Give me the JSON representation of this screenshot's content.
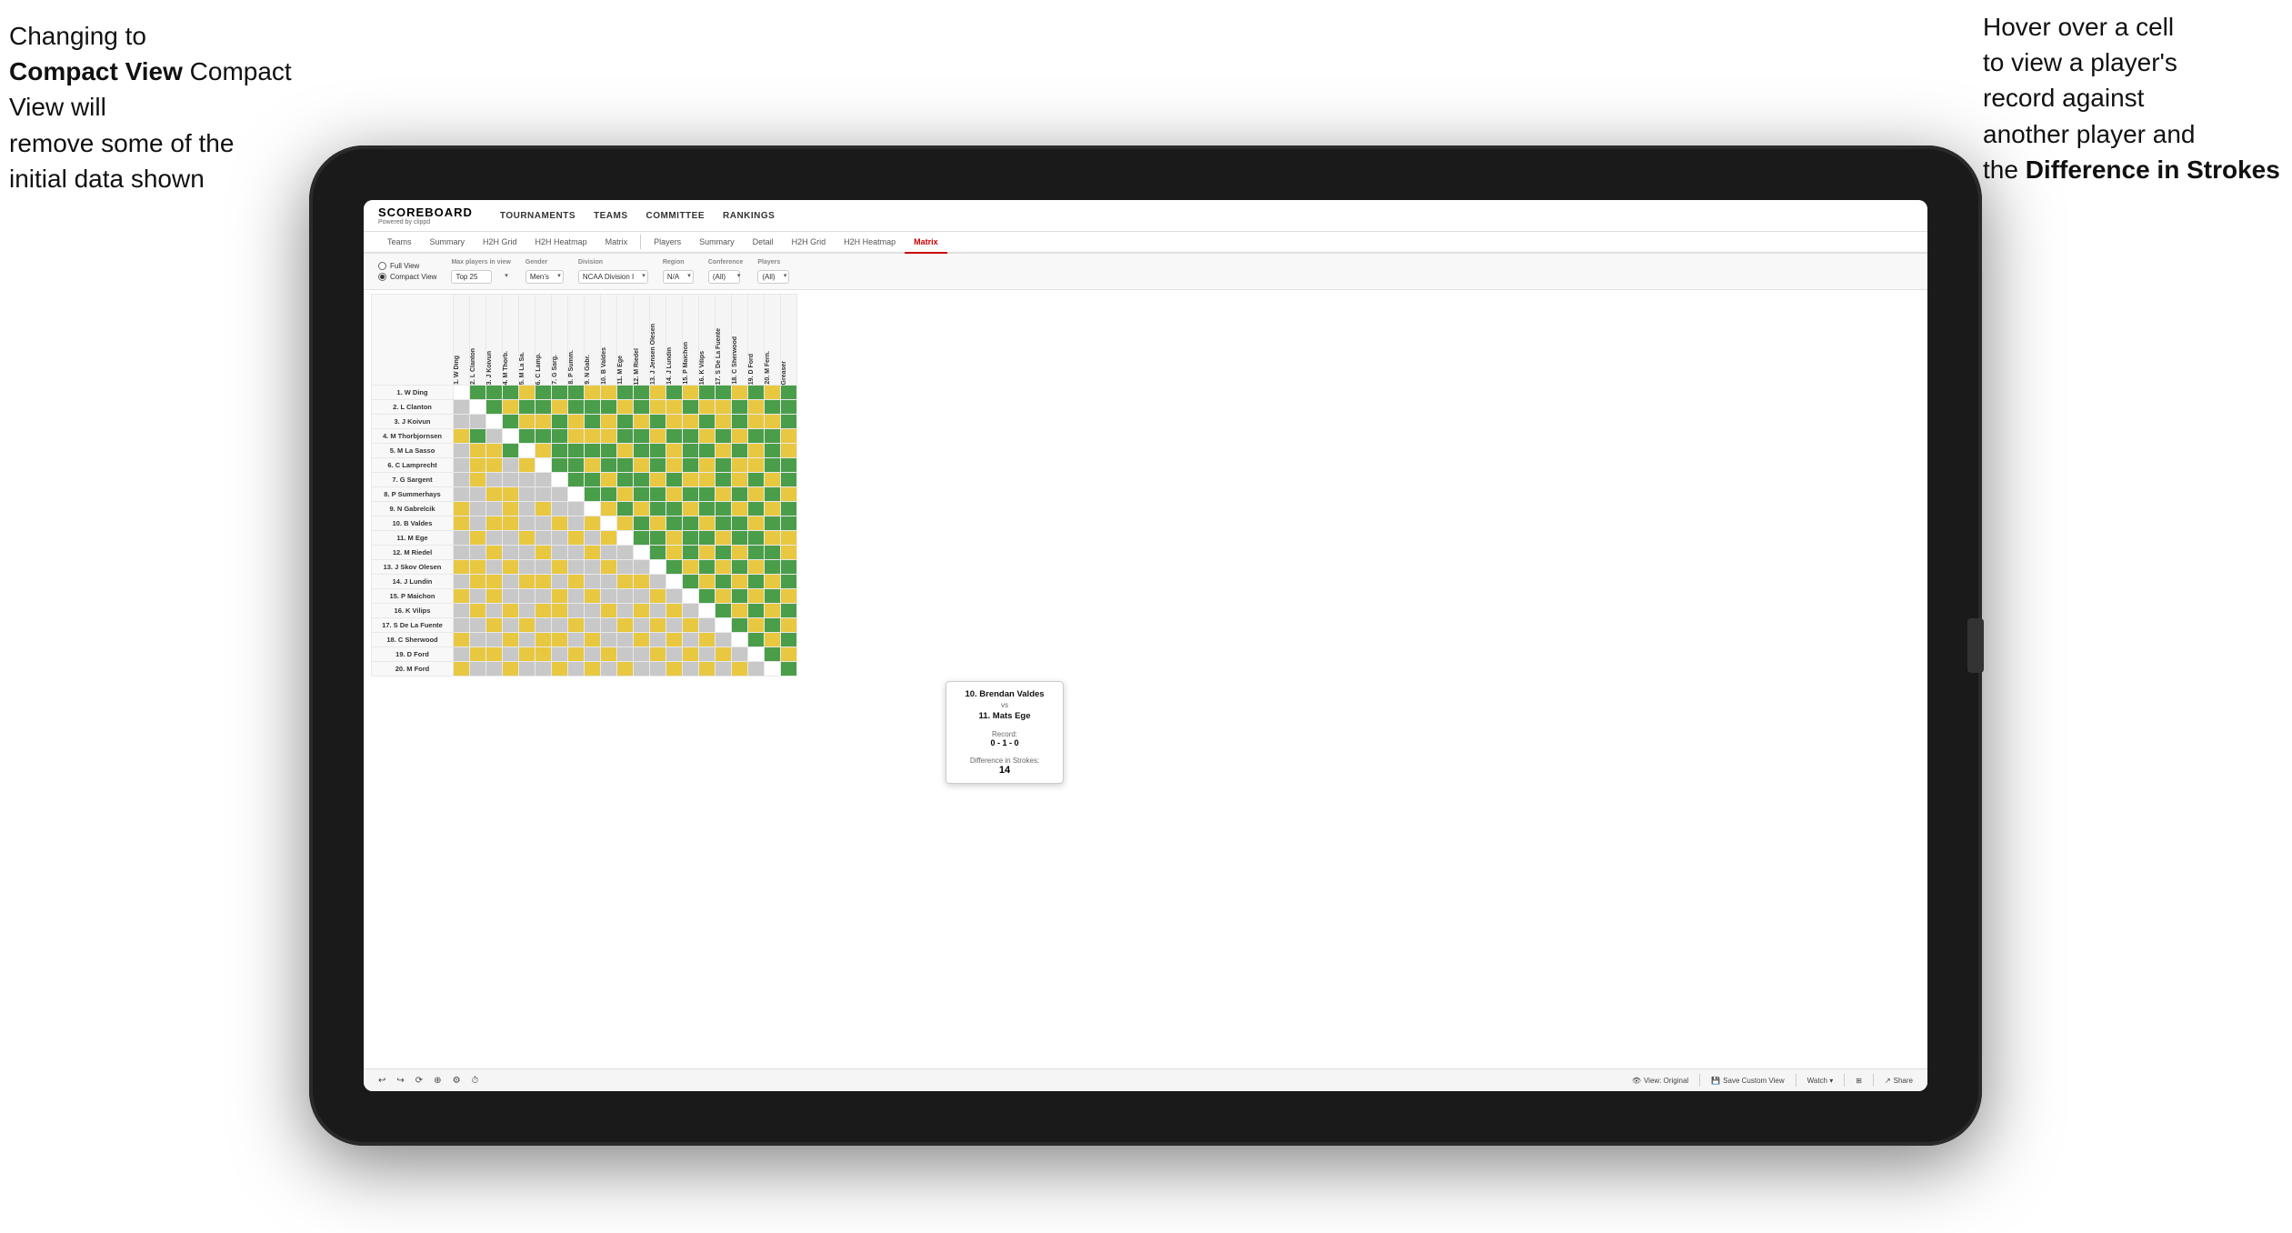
{
  "annotations": {
    "left_line1": "Changing to",
    "left_line2": "Compact View will",
    "left_line3": "remove some of the",
    "left_line4": "initial data shown",
    "right_line1": "Hover over a cell",
    "right_line2": "to view a player's",
    "right_line3": "record against",
    "right_line4": "another player and",
    "right_line5": "the ",
    "right_bold": "Difference in Strokes"
  },
  "header": {
    "logo_main": "SCOREBOARD",
    "logo_sub": "Powered by clippd",
    "nav": [
      "TOURNAMENTS",
      "TEAMS",
      "COMMITTEE",
      "RANKINGS"
    ]
  },
  "tabs": {
    "group1": [
      "Teams",
      "Summary",
      "H2H Grid",
      "H2H Heatmap",
      "Matrix"
    ],
    "group2": [
      "Players",
      "Summary",
      "Detail",
      "H2H Grid",
      "H2H Heatmap",
      "Matrix"
    ],
    "active": "Matrix"
  },
  "controls": {
    "view_options": [
      "Full View",
      "Compact View"
    ],
    "active_view": "Compact View",
    "max_players_label": "Max players in view",
    "max_players_value": "Top 25",
    "gender_label": "Gender",
    "gender_value": "Men's",
    "division_label": "Division",
    "division_value": "NCAA Division I",
    "region_label": "Region",
    "region_value": "N/A",
    "conference_label": "Conference",
    "conference_value": "(All)",
    "players_label": "Players",
    "players_value": "(All)"
  },
  "players": [
    "1. W Ding",
    "2. L Clanton",
    "3. J Koivun",
    "4. M Thorbjornsen",
    "5. M La Sasso",
    "6. C Lamprecht",
    "7. G Sargent",
    "8. P Summerhays",
    "9. N Gabrelcik",
    "10. B Valdes",
    "11. M Ege",
    "12. M Riedel",
    "13. J Skov Olesen",
    "14. J Lundin",
    "15. P Maichon",
    "16. K Vilips",
    "17. S De La Fuente",
    "18. C Sherwood",
    "19. D Ford",
    "20. M Ford"
  ],
  "col_headers": [
    "1. W Ding",
    "2. L Clanton",
    "3. J Koivun",
    "4. M Thorb...",
    "5. M La Sa...",
    "6. C Lampr...",
    "7. G Sarge...",
    "8. P Summ...",
    "9. N Gabr...",
    "10. B Vald...",
    "11. M Ege",
    "12. M Riedel",
    "13. J Skov...",
    "14. J Lundin",
    "15. P Maich...",
    "16. K Vilips",
    "17. S De La...",
    "18. C Sher...",
    "19. D Ford",
    "20. M Ford",
    "Greaser"
  ],
  "tooltip": {
    "player1": "10. Brendan Valdes",
    "vs": "vs",
    "player2": "11. Mats Ege",
    "record_label": "Record:",
    "record": "0 - 1 - 0",
    "diff_label": "Difference in Strokes:",
    "diff": "14"
  },
  "toolbar": {
    "undo": "↩",
    "redo": "↪",
    "view_original": "View: Original",
    "save_custom": "Save Custom View",
    "watch": "Watch ▾",
    "share": "Share"
  }
}
